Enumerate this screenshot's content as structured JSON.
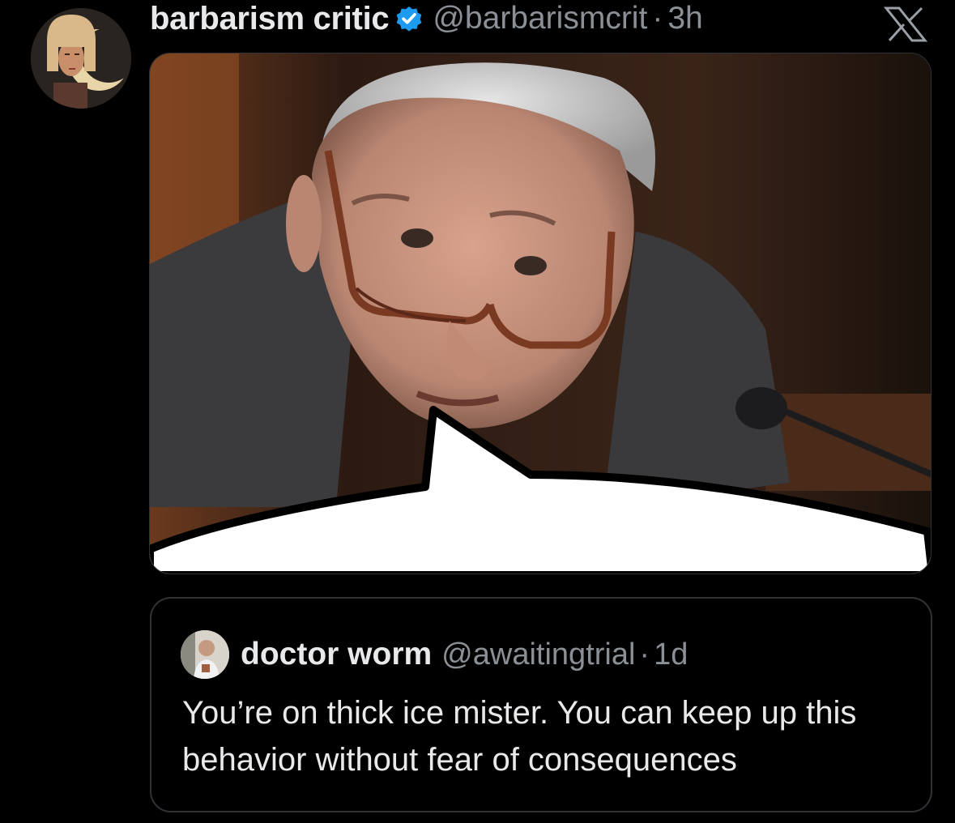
{
  "tweet": {
    "display_name": "barbarism critic",
    "handle": "@barbarismcrit",
    "separator": "·",
    "time": "3h",
    "verified": true,
    "avatar_icon": "woman-with-bob-haircut-avatar",
    "media_icon": "photo-man-with-glasses-speech-bubble"
  },
  "platform": {
    "logo_icon": "x-logo-icon"
  },
  "quote": {
    "display_name": "doctor worm",
    "handle": "@awaitingtrial",
    "separator": "·",
    "time": "1d",
    "text": "You’re on thick ice mister. You can keep up this behavior without fear of consequences",
    "avatar_icon": "person-photo-avatar"
  },
  "colors": {
    "background": "#000000",
    "text_primary": "#e7e9ea",
    "text_secondary": "#8b9096",
    "verified_badge": "#1d9bf0",
    "border": "#2f3336"
  }
}
